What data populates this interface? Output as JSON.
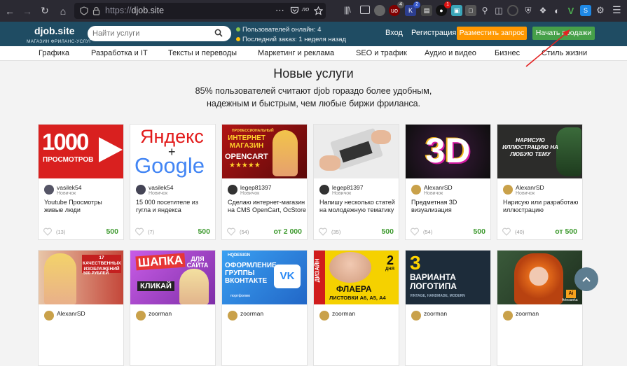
{
  "browser": {
    "url_scheme": "https://",
    "url_host": "djob.site",
    "badges": {
      "ext1": "4",
      "ext2": "2",
      "ext3": "1"
    }
  },
  "header": {
    "logo": "djob.site",
    "logo_sub": "МАГАЗИН ФРИЛАНС-УСЛУГ",
    "search_placeholder": "Найти услуги",
    "online": "Пользователей онлайн: 4",
    "last_order": "Последний заказ: 1 неделя назад",
    "login": "Вход",
    "register": "Регистрация",
    "post_request": "Разместить запрос",
    "start_selling": "Начать продажи",
    "online_color": "#8bc34a",
    "order_color": "#ffc107"
  },
  "categories": [
    "Графика",
    "Разработка и IT",
    "Тексты и переводы",
    "Маркетинг и реклама",
    "SEO и трафик",
    "Аудио и видео",
    "Бизнес",
    "Стиль жизни"
  ],
  "hero": {
    "title": "Новые услуги",
    "subtitle": "85% пользователей считают djob гораздо более удобным, надежным и быстрым, чем любые биржи фриланса."
  },
  "cards_row1": [
    {
      "seller": "vasilek54",
      "level": "Новичок",
      "title": "Youtube Просмотры живые люди",
      "count": "(13)",
      "price": "500",
      "img": {
        "bg": "#d9201f",
        "big": "1000",
        "small": "ПРОСМОТРОВ"
      }
    },
    {
      "seller": "vasilek54",
      "level": "Новичок",
      "title": "15 000 посетителе из гугла и яндекса",
      "count": "(7)",
      "price": "500",
      "img": {
        "bg": "#ffffff",
        "big": "Яндекс",
        "plus": "+",
        "small": "Google"
      }
    },
    {
      "seller": "legep81397",
      "level": "Новичок",
      "title": "Сделаю интернет-магазин на CMS OpenCart, OcStore под ключ",
      "count": "(54)",
      "price": "от 2 000",
      "img": {
        "bg": "#8e1010",
        "top": "ПРОФЕССИОНАЛЬНЫЙ",
        "big": "ИНТЕРНЕТ МАГАЗИН",
        "small": "OPENCART",
        "stars": "★★★★★"
      }
    },
    {
      "seller": "legep81397",
      "level": "Новичок",
      "title": "Напишу несколько статей на молодежную тематику",
      "count": "(35)",
      "price": "500",
      "img": {
        "bg": "#e8e8e8"
      }
    },
    {
      "seller": "AlexanrSD",
      "level": "Новичок",
      "title": "Предметная 3D визуализация",
      "count": "(54)",
      "price": "500",
      "img": {
        "bg": "#1b1b1b",
        "big": "3D"
      }
    },
    {
      "seller": "AlexanrSD",
      "level": "Новичок",
      "title": "Нарисую или разработаю иллюстрацию",
      "count": "(40)",
      "price": "от 500",
      "img": {
        "bg": "#2a2a28",
        "big": "НАРИСУЮ ИЛЛЮСТРАЦИЮ НА ЛЮБУЮ ТЕМУ"
      }
    }
  ],
  "cards_row2": [
    {
      "seller": "AlexanrSD",
      "img": {
        "bg": "#c4473a",
        "small": "17 КАЧЕСТВЕННЫХ ИЗОБРАЖЕНИЙ",
        "tag": "500 РУБЛЕЙ"
      }
    },
    {
      "seller": "zoorman",
      "img": {
        "bg": "#b64ad1",
        "big": "ШАПКА",
        "big2": "ДЛЯ САЙТА",
        "small": "КЛИКАЙ"
      }
    },
    {
      "seller": "zoorman",
      "img": {
        "bg": "#2b8fe0",
        "brand": "HQDESIGN",
        "big": "ОФОРМЛЕНИЕ ГРУППЫ ВКОНТАКТЕ",
        "tag": "портфолио"
      }
    },
    {
      "seller": "zoorman",
      "img": {
        "bg": "#f5d100",
        "side": "ДИЗАЙН",
        "num": "2",
        "days": "ДНЯ",
        "big": "ФЛАЕРА",
        "small": "ЛИСТОВКИ А6, А5, А4"
      }
    },
    {
      "seller": "zoorman",
      "img": {
        "bg": "#1d2c3a",
        "num": "3",
        "big": "ВАРИАНТА ЛОГОТИПА",
        "small": "VINTAGE, HANDMADE, MODERN"
      }
    },
    {
      "seller": "zoorman",
      "img": {
        "bg": "#2a3a2a",
        "tag": "Artesanka"
      }
    }
  ]
}
